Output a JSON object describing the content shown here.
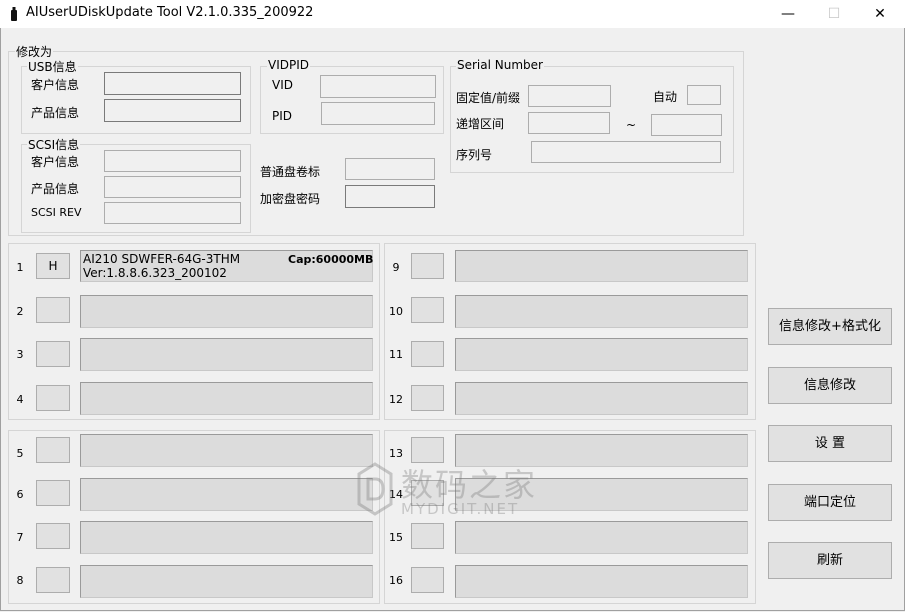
{
  "window": {
    "title": "AIUserUDiskUpdate Tool V2.1.0.335_200922",
    "minimize": "—",
    "maximize": "☐",
    "close": "✕"
  },
  "modify": {
    "legend": "修改为",
    "usb": {
      "legend": "USB信息",
      "customer_label": "客户信息",
      "product_label": "产品信息"
    },
    "vidpid": {
      "legend": "VIDPID",
      "vid_label": "VID",
      "pid_label": "PID"
    },
    "serial": {
      "legend": "Serial Number",
      "fixed_label": "固定值/前缀",
      "auto_label": "自动",
      "range_label": "递增区间",
      "tilde": "~",
      "seq_label": "序列号"
    },
    "scsi": {
      "legend": "SCSI信息",
      "customer_label": "客户信息",
      "product_label": "产品信息",
      "rev_label": "SCSI REV"
    },
    "normal_volume_label": "普通盘卷标",
    "encrypted_password_label": "加密盘密码"
  },
  "slots": {
    "s1": {
      "num": "1",
      "button": "H",
      "line1": "AI210   SDWFER-64G-3THM",
      "cap": "Cap:60000MB",
      "line2": "Ver:1.8.8.6.323_200102"
    },
    "s2": {
      "num": "2"
    },
    "s3": {
      "num": "3"
    },
    "s4": {
      "num": "4"
    },
    "s5": {
      "num": "5"
    },
    "s6": {
      "num": "6"
    },
    "s7": {
      "num": "7"
    },
    "s8": {
      "num": "8"
    },
    "s9": {
      "num": "9"
    },
    "s10": {
      "num": "10"
    },
    "s11": {
      "num": "11"
    },
    "s12": {
      "num": "12"
    },
    "s13": {
      "num": "13"
    },
    "s14": {
      "num": "14"
    },
    "s15": {
      "num": "15"
    },
    "s16": {
      "num": "16"
    }
  },
  "actions": {
    "modify_format": "信息修改+格式化",
    "modify": "信息修改",
    "settings": "设 置",
    "port_locate": "端口定位",
    "refresh": "刷新"
  },
  "watermark": {
    "cn": "数码之家",
    "en": "MYDIGIT.NET"
  }
}
